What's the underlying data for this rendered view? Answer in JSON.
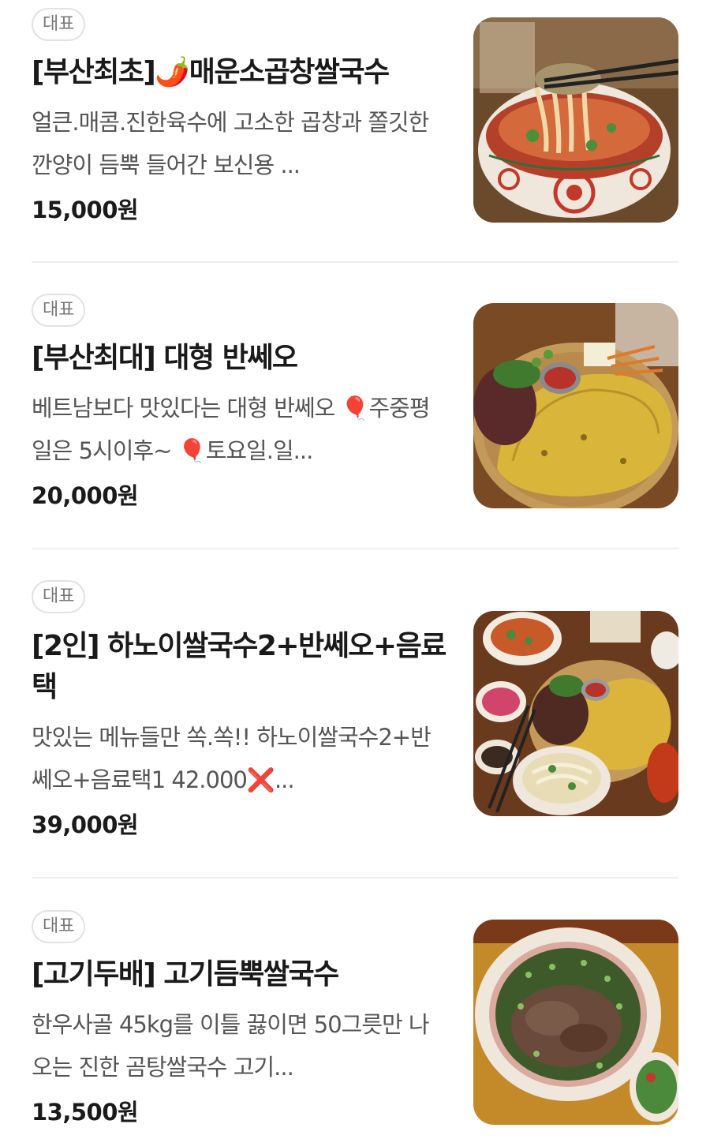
{
  "menu": {
    "items": [
      {
        "badge": "대표",
        "name": "[부산최초]🌶️매운소곱창쌀국수",
        "description": "얼큰.매콤.진한육수에 고소한 곱창과 쫄깃한 깐양이 듬뿍 들어간 보신용 ...",
        "price": "15,000원",
        "photo": "spicy-tripe-rice-noodle-photo"
      },
      {
        "badge": "대표",
        "name": "[부산최대] 대형 반쎄오",
        "description": "베트남보다 맛있다는 대형 반쎄오 🎈주중평일은 5시이후~ 🎈토요일.일...",
        "price": "20,000원",
        "photo": "banh-xeo-photo"
      },
      {
        "badge": "대표",
        "name": "[2인] 하노이쌀국수2+반쎄오+음료택",
        "description": "맛있는 메뉴들만 쏙.쏙!! 하노이쌀국수2+반쎄오+음료택1 42.000❌...",
        "price": "39,000원",
        "photo": "set-for-two-photo"
      },
      {
        "badge": "대표",
        "name": "[고기두배] 고기듬뿍쌀국수",
        "description": "한우사골 45kg를 이틀 끓이면 50그릇만 나오는 진한 곰탕쌀국수 고기...",
        "price": "13,500원",
        "photo": "beef-rice-noodle-photo"
      }
    ]
  }
}
